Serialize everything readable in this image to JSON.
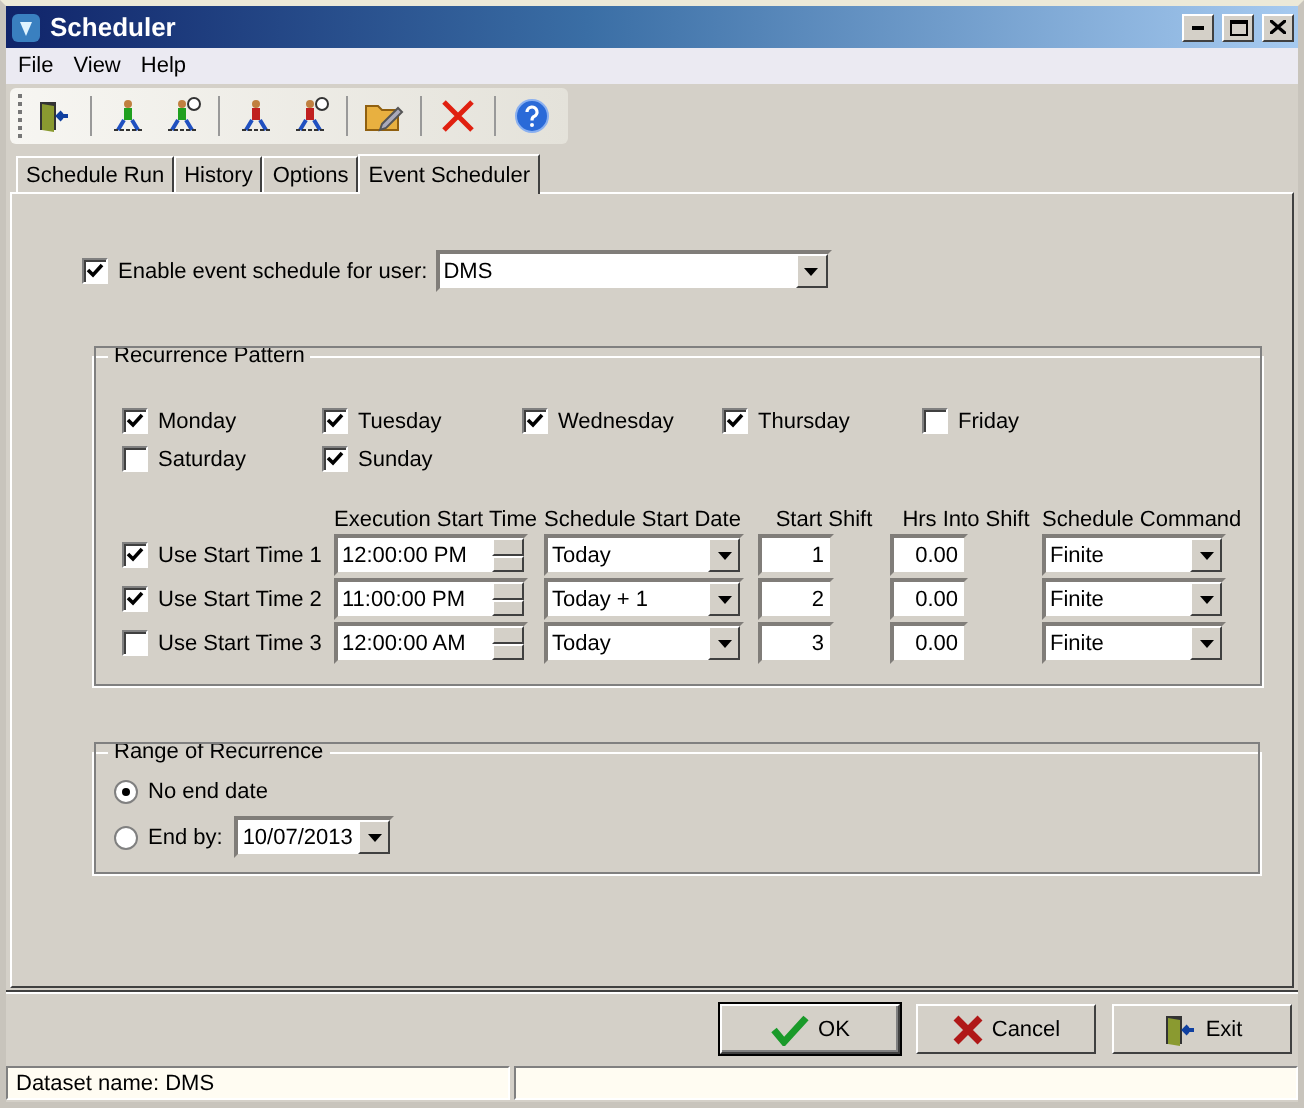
{
  "window": {
    "title": "Scheduler"
  },
  "menu": [
    "File",
    "View",
    "Help"
  ],
  "tabs": [
    {
      "label": "Schedule Run",
      "selected": false
    },
    {
      "label": "History",
      "selected": false
    },
    {
      "label": "Options",
      "selected": false
    },
    {
      "label": "Event Scheduler",
      "selected": true
    }
  ],
  "enable": {
    "label": "Enable event schedule for user:",
    "checked": true,
    "user": "DMS"
  },
  "recurrence": {
    "title": "Recurrence Pattern",
    "days": [
      {
        "label": "Monday",
        "checked": true
      },
      {
        "label": "Tuesday",
        "checked": true
      },
      {
        "label": "Wednesday",
        "checked": true
      },
      {
        "label": "Thursday",
        "checked": true
      },
      {
        "label": "Friday",
        "checked": false
      },
      {
        "label": "Saturday",
        "checked": false
      },
      {
        "label": "Sunday",
        "checked": true
      }
    ],
    "columns": [
      "Execution Start Time",
      "Schedule Start Date",
      "Start Shift",
      "Hrs Into Shift",
      "Schedule Command"
    ],
    "start_times": [
      {
        "label": "Use Start Time 1",
        "checked": true,
        "time": "12:00:00 PM",
        "date": "Today",
        "shift": "1",
        "hrs": "0.00",
        "command": "Finite"
      },
      {
        "label": "Use Start Time 2",
        "checked": true,
        "time": "11:00:00 PM",
        "date": "Today + 1",
        "shift": "2",
        "hrs": "0.00",
        "command": "Finite"
      },
      {
        "label": "Use Start Time 3",
        "checked": false,
        "time": "12:00:00 AM",
        "date": "Today",
        "shift": "3",
        "hrs": "0.00",
        "command": "Finite"
      }
    ]
  },
  "range": {
    "title": "Range of Recurrence",
    "options": [
      {
        "label": "No end date",
        "selected": true
      },
      {
        "label": "End by:",
        "selected": false,
        "date": "10/07/2013"
      }
    ]
  },
  "buttons": [
    {
      "kind": "ok",
      "label": "OK"
    },
    {
      "kind": "cancel",
      "label": "Cancel"
    },
    {
      "kind": "exit",
      "label": "Exit"
    }
  ],
  "status_bar": {
    "dataset": "Dataset name:  DMS"
  }
}
